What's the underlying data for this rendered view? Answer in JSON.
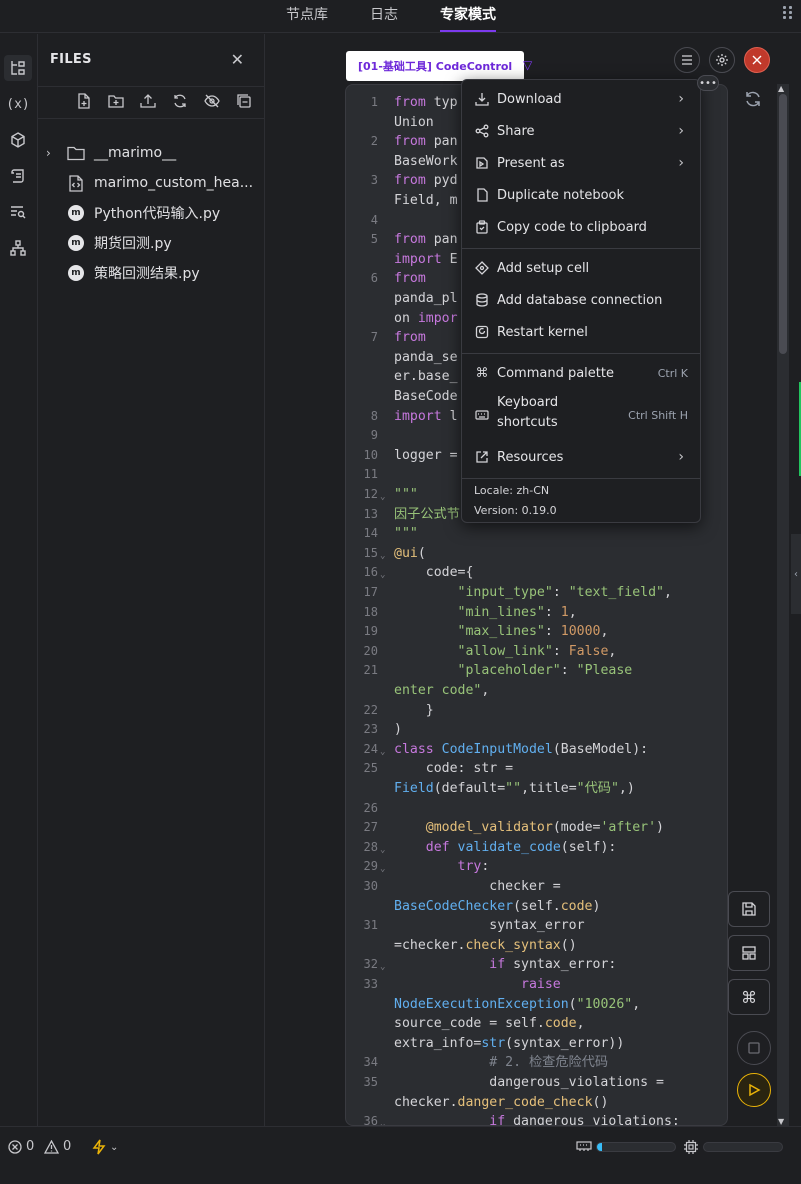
{
  "top_tabs": [
    "节点库",
    "日志",
    "专家模式"
  ],
  "files_panel": {
    "title": "FILES",
    "items": [
      {
        "name": "__marimo__",
        "type": "folder"
      },
      {
        "name": "marimo_custom_hea...",
        "type": "file"
      },
      {
        "name": "Python代码输入.py",
        "type": "marimo"
      },
      {
        "name": "期货回测.py",
        "type": "marimo"
      },
      {
        "name": "策略回测结果.py",
        "type": "marimo"
      }
    ]
  },
  "cell": {
    "name": "[01-基础工具] CodeControl",
    "line_numbers": [
      "1",
      "",
      "2",
      "",
      "3",
      "",
      "4",
      "5",
      "",
      "6",
      "",
      "",
      "7",
      "",
      "",
      "",
      "8",
      "9",
      "10",
      "11",
      "12",
      "13",
      "14",
      "15",
      "16",
      "17",
      "18",
      "19",
      "20",
      "21",
      "",
      "22",
      "23",
      "24",
      "25",
      "",
      "26",
      "27",
      "28",
      "29",
      "30",
      "",
      "31",
      "",
      "32",
      "33",
      "",
      "",
      "",
      "34",
      "35",
      "",
      "36"
    ]
  },
  "menu": {
    "items": [
      {
        "label": "Download",
        "icon": "download-icon",
        "submenu": true
      },
      {
        "label": "Share",
        "icon": "share-icon",
        "submenu": true
      },
      {
        "label": "Present as",
        "icon": "present-icon",
        "submenu": true
      },
      {
        "label": "Duplicate notebook",
        "icon": "duplicate-icon",
        "submenu": false
      },
      {
        "label": "Copy code to clipboard",
        "icon": "clipboard-icon",
        "submenu": false
      },
      {
        "label": "Add setup cell",
        "icon": "setup-icon",
        "submenu": false
      },
      {
        "label": "Add database connection",
        "icon": "database-icon",
        "submenu": false
      },
      {
        "label": "Restart kernel",
        "icon": "restart-icon",
        "submenu": false
      },
      {
        "label": "Command palette",
        "icon": "command-icon",
        "shortcut": "Ctrl K"
      },
      {
        "label": "Keyboard",
        "label2": "shortcuts",
        "icon": "keyboard-icon",
        "shortcut": "Ctrl Shift H"
      },
      {
        "label": "Resources",
        "icon": "external-link-icon",
        "submenu": true
      }
    ],
    "locale": "Locale: zh-CN",
    "version": "Version: 0.19.0"
  },
  "status": {
    "errors": "0",
    "warnings": "0",
    "progress_fraction": 0.07
  },
  "colors": {
    "accent": "#7c3aed",
    "close_red": "#c0392b",
    "run_yellow": "#eab308",
    "progress": "#38bdf8"
  }
}
